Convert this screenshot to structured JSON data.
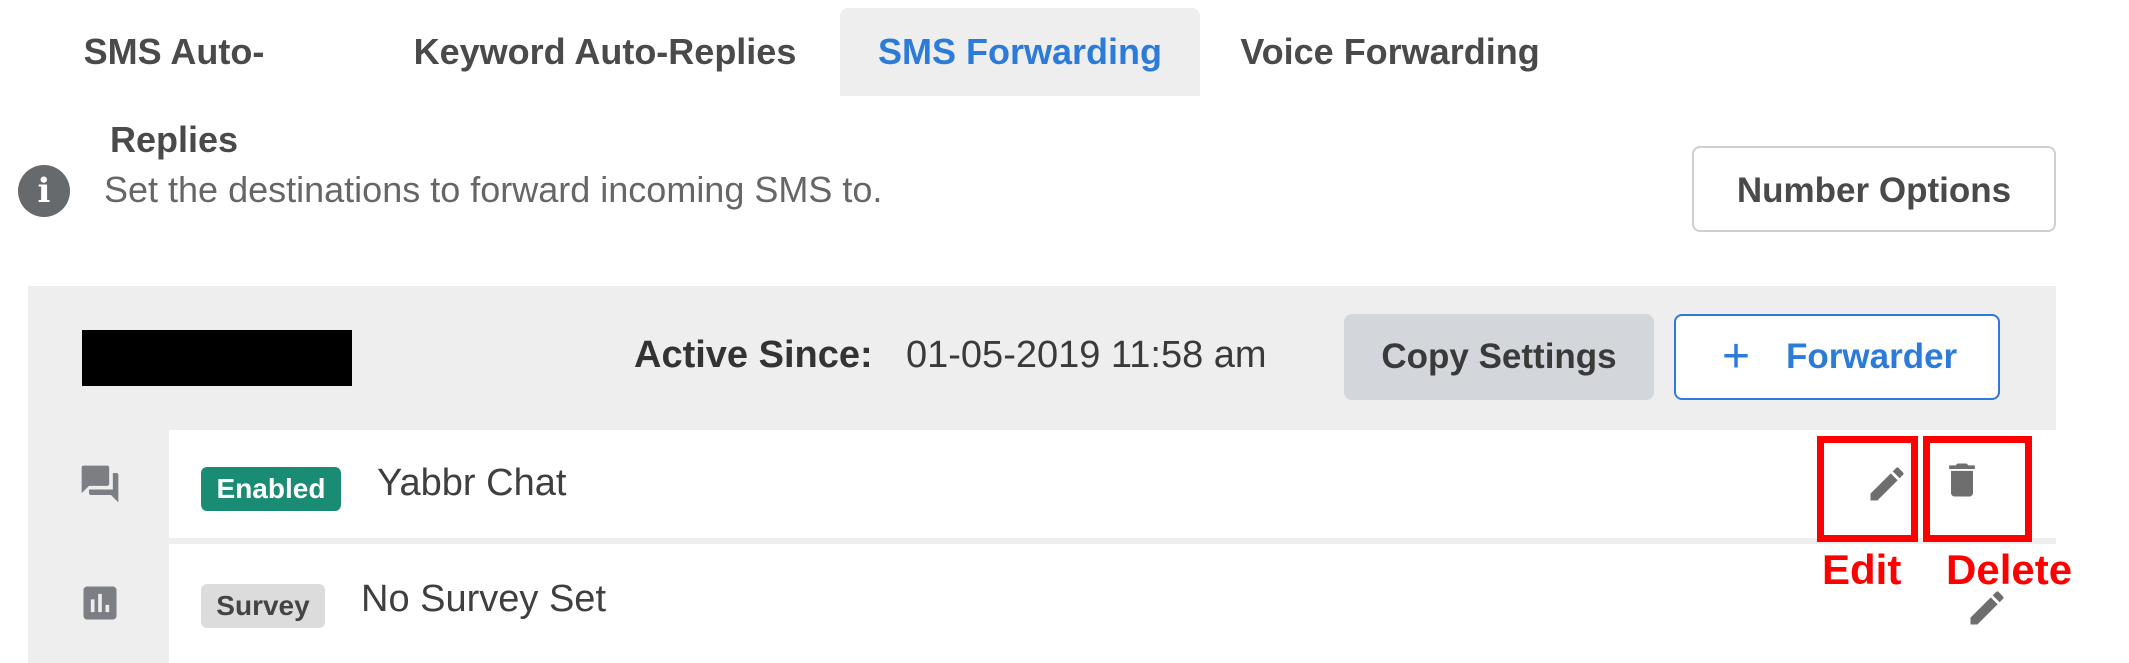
{
  "tabs": [
    {
      "label": "SMS Auto-Replies",
      "active": false
    },
    {
      "label": "Keyword Auto-Replies",
      "active": false
    },
    {
      "label": "SMS Forwarding",
      "active": true
    },
    {
      "label": "Voice Forwarding",
      "active": false
    }
  ],
  "info": {
    "text": "Set the destinations to forward incoming SMS to.",
    "icon": "info-icon"
  },
  "number_options_label": "Number Options",
  "panel": {
    "active_since_label": "Active Since:",
    "active_since_value": "01-05-2019 11:58 am",
    "copy_settings_label": "Copy Settings",
    "forwarder_button": {
      "plus": "+",
      "label": "Forwarder"
    },
    "rows": [
      {
        "icon": "chat-icon",
        "badge": "Enabled",
        "text": "Yabbr Chat",
        "actions": [
          "edit-icon",
          "delete-icon"
        ]
      },
      {
        "icon": "bar-chart-icon",
        "badge": "Survey",
        "text": "No Survey Set",
        "actions": [
          "edit-icon"
        ]
      }
    ]
  },
  "annotations": {
    "edit_label": "Edit",
    "delete_label": "Delete"
  },
  "colors": {
    "accent": "#2d7bd8",
    "enabled_badge": "#1a8c74",
    "highlight": "#ff0000",
    "panel_bg": "#eeeeee"
  }
}
